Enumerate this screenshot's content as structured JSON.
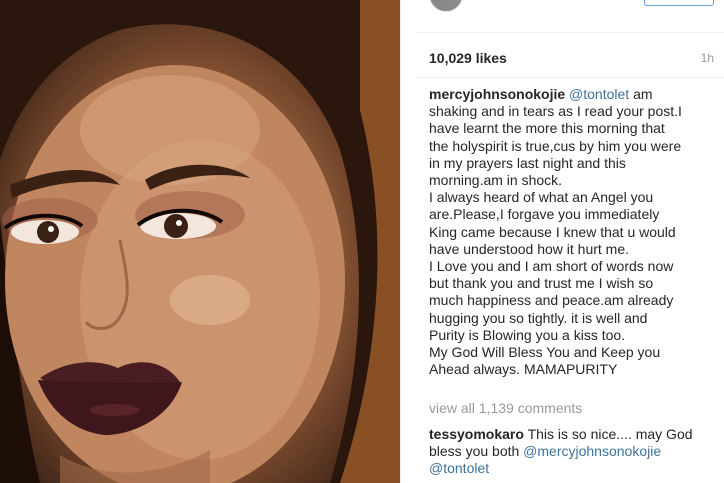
{
  "post": {
    "likes": "10,029 likes",
    "time": "1h"
  },
  "comments": [
    {
      "username": "mercyjohnsonokojie",
      "mention": "@tontolet",
      "first_line_rest": " am",
      "lines": [
        "shaking and in tears as I read your post.I",
        "have learnt the more this morning that",
        "the holyspirit is true,cus by him you were",
        "in my prayers last night and this",
        "morning.am in shock.",
        "I always heard of what an Angel you",
        "are.Please,I forgave you immediately",
        "King came because I knew that u would",
        "have understood how it hurt me.",
        "I Love you and I am short of words now",
        "but thank you and trust me I wish so",
        "much happiness and peace.am already",
        "hugging you so tightly. it is well and",
        "Purity is Blowing you a kiss too.",
        "My God Will Bless You and Keep you",
        "Ahead always. MAMAPURITY"
      ]
    },
    {
      "username": "tessyomokaro",
      "text_first": " This is so nice.... may God",
      "text_second": "bless you both ",
      "mention_1": "@mercyjohnsonokojie",
      "mention_2": "@tontolet"
    }
  ],
  "view_all_comments": "view all 1,139 comments",
  "colors": {
    "mention": "#3f729b",
    "muted": "#999999",
    "text": "#262626",
    "lipstick": "#4a1d22"
  }
}
